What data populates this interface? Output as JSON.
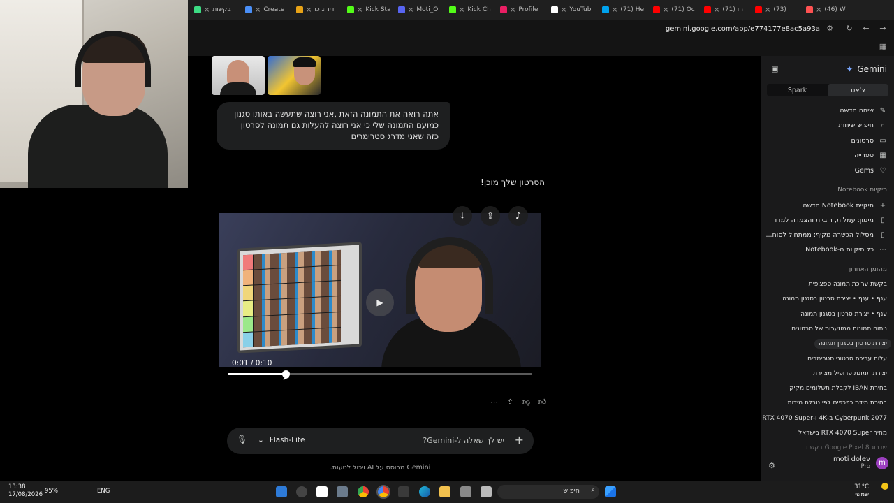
{
  "browser": {
    "tabs": [
      {
        "label": "בקשות",
        "color": "#3ddc84",
        "active": false
      },
      {
        "label": "Create",
        "color": "#4a8ff7",
        "active": false
      },
      {
        "label": "דירוג כו",
        "color": "#e8a317",
        "active": false
      },
      {
        "label": "Kick Sta",
        "color": "#53fc18",
        "active": false
      },
      {
        "label": "Moti_O",
        "color": "#5865f2",
        "active": false
      },
      {
        "label": "Kick Ch",
        "color": "#53fc18",
        "active": false
      },
      {
        "label": "Profile",
        "color": "#e91e63",
        "active": false
      },
      {
        "label": "YouTub",
        "color": "#ffffff",
        "active": false
      },
      {
        "label": "(71) He",
        "color": "#00a2ed",
        "active": false
      },
      {
        "label": "(71) Oc",
        "color": "#ff0000",
        "active": false
      },
      {
        "label": "(71) הו",
        "color": "#ff0000",
        "active": false
      },
      {
        "label": "(73)",
        "color": "#ff0000",
        "active": false
      },
      {
        "label": "(46) W",
        "color": "#ff5252",
        "active": false
      }
    ],
    "url": "gemini.google.com/app/e774177e8ac5a93a"
  },
  "chat": {
    "user_message": "אתה רואה את התמונה הזאת ,אני רוצה שתעשה באותו סגנון כמועם התמונה שלי כי אני רוצה להעלות גם תמונה לסרטון כזה שאני מדרג סטרימרים",
    "reply_text": "הסרטון שלך מוכן!",
    "video": {
      "time": "0:01 / 0:10",
      "progress": 0.19
    },
    "composer": {
      "placeholder": "יש לך שאלה ל-Gemini?",
      "model": "Flash-Lite"
    },
    "disclaimer": "Gemini מבוסס על AI ויכול לטעות."
  },
  "sidebar": {
    "brand": "Gemini",
    "toggle": {
      "chats": "צ'אט",
      "spark": "Spark"
    },
    "nav": [
      {
        "label": "שיחה חדשה",
        "icon": "✎"
      },
      {
        "label": "חיפוש שיחות",
        "icon": "⌕"
      },
      {
        "label": "סרטונים",
        "icon": "▭"
      },
      {
        "label": "ספרייה",
        "icon": "▦"
      },
      {
        "label": "Gems",
        "icon": "♡"
      }
    ],
    "notebooks_heading": "תיקיות Notebook",
    "notebooks": [
      {
        "label": "תיקיית Notebook חדשה",
        "icon": "+"
      },
      {
        "label": "מימון: עמלות, ריביות והצמדה למדד",
        "icon": "▯"
      },
      {
        "label": "מסלול הכשרה מקיף: ממתחיל לסוח...",
        "icon": "▯"
      },
      {
        "label": "כל תיקיות ה-Notebook",
        "icon": "⋯"
      }
    ],
    "recent_heading": "מהזמן האחרון",
    "recent": [
      {
        "label": "בקשת עריכת תמונה ספציפית",
        "active": false
      },
      {
        "label": "ענף • ענף • יצירת סרטון בסגנון תמונה",
        "active": false
      },
      {
        "label": "ענף • יצירת סרטון בסגנון תמונה",
        "active": false
      },
      {
        "label": "ניתוח תמונות ממוזערות של סרטונים",
        "active": false
      },
      {
        "label": "יצירת סרטון בסגנון תמונה",
        "active": true
      },
      {
        "label": "עלות עריכת סרטוני סטרימרים",
        "active": false
      },
      {
        "label": "יצירת תמונת פרופיל מצוירת",
        "active": false
      },
      {
        "label": "בחירת IBAN לקבלת תשלומים מקיק",
        "active": false
      },
      {
        "label": "בחירת מידת כפכפים לפי טבלת מידות",
        "active": false
      },
      {
        "label": "Cyberpunk 2077 ב-4K ו-RTX 4070 Super",
        "active": false
      },
      {
        "label": "מחיר RTX 4070 Super בישראל",
        "active": false
      },
      {
        "label": "שדרוג Google Pixel 8 בקשת",
        "active": false
      }
    ],
    "user": {
      "name": "moti dolev",
      "plan": "Pro",
      "initial": "m"
    }
  },
  "taskbar": {
    "time": "13:38",
    "date": "17/08/2026",
    "battery": "95%",
    "lang": "ENG",
    "search": "חיפוש",
    "temp": "31°C",
    "weather": "שמשי"
  }
}
